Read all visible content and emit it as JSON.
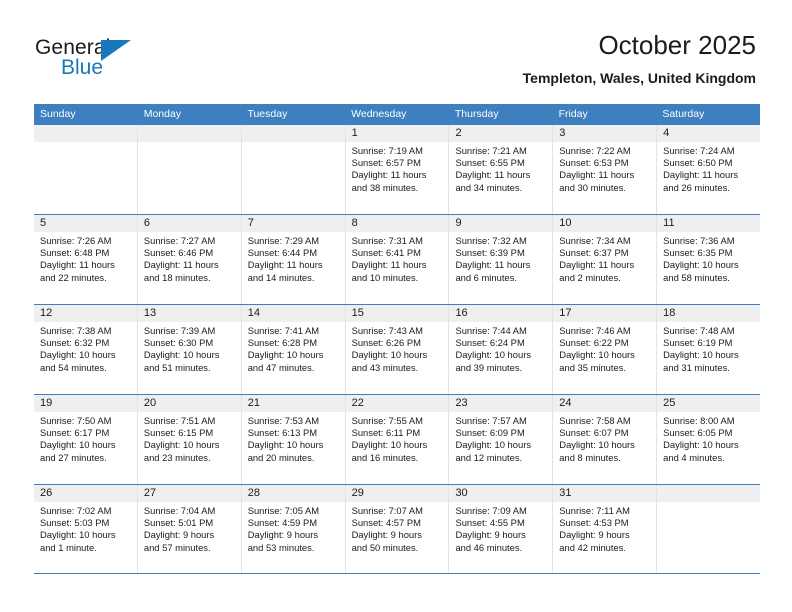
{
  "brand": {
    "name_top": "General",
    "name_bottom": "Blue",
    "triangle_icon": "triangle-icon",
    "accent_color": "#1878be"
  },
  "header": {
    "title": "October 2025",
    "subtitle": "Templeton, Wales, United Kingdom"
  },
  "theme": {
    "header_blue": "#3d7fbf",
    "day_strip_gray": "#efefef",
    "cell_border": "#e3e3e3",
    "text": "#1b1b1b"
  },
  "weekdays": [
    "Sunday",
    "Monday",
    "Tuesday",
    "Wednesday",
    "Thursday",
    "Friday",
    "Saturday"
  ],
  "weeks": [
    [
      {
        "day": "",
        "sunrise": "",
        "sunset": "",
        "daylight1": "",
        "daylight2": ""
      },
      {
        "day": "",
        "sunrise": "",
        "sunset": "",
        "daylight1": "",
        "daylight2": ""
      },
      {
        "day": "",
        "sunrise": "",
        "sunset": "",
        "daylight1": "",
        "daylight2": ""
      },
      {
        "day": "1",
        "sunrise": "Sunrise: 7:19 AM",
        "sunset": "Sunset: 6:57 PM",
        "daylight1": "Daylight: 11 hours",
        "daylight2": "and 38 minutes."
      },
      {
        "day": "2",
        "sunrise": "Sunrise: 7:21 AM",
        "sunset": "Sunset: 6:55 PM",
        "daylight1": "Daylight: 11 hours",
        "daylight2": "and 34 minutes."
      },
      {
        "day": "3",
        "sunrise": "Sunrise: 7:22 AM",
        "sunset": "Sunset: 6:53 PM",
        "daylight1": "Daylight: 11 hours",
        "daylight2": "and 30 minutes."
      },
      {
        "day": "4",
        "sunrise": "Sunrise: 7:24 AM",
        "sunset": "Sunset: 6:50 PM",
        "daylight1": "Daylight: 11 hours",
        "daylight2": "and 26 minutes."
      }
    ],
    [
      {
        "day": "5",
        "sunrise": "Sunrise: 7:26 AM",
        "sunset": "Sunset: 6:48 PM",
        "daylight1": "Daylight: 11 hours",
        "daylight2": "and 22 minutes."
      },
      {
        "day": "6",
        "sunrise": "Sunrise: 7:27 AM",
        "sunset": "Sunset: 6:46 PM",
        "daylight1": "Daylight: 11 hours",
        "daylight2": "and 18 minutes."
      },
      {
        "day": "7",
        "sunrise": "Sunrise: 7:29 AM",
        "sunset": "Sunset: 6:44 PM",
        "daylight1": "Daylight: 11 hours",
        "daylight2": "and 14 minutes."
      },
      {
        "day": "8",
        "sunrise": "Sunrise: 7:31 AM",
        "sunset": "Sunset: 6:41 PM",
        "daylight1": "Daylight: 11 hours",
        "daylight2": "and 10 minutes."
      },
      {
        "day": "9",
        "sunrise": "Sunrise: 7:32 AM",
        "sunset": "Sunset: 6:39 PM",
        "daylight1": "Daylight: 11 hours",
        "daylight2": "and 6 minutes."
      },
      {
        "day": "10",
        "sunrise": "Sunrise: 7:34 AM",
        "sunset": "Sunset: 6:37 PM",
        "daylight1": "Daylight: 11 hours",
        "daylight2": "and 2 minutes."
      },
      {
        "day": "11",
        "sunrise": "Sunrise: 7:36 AM",
        "sunset": "Sunset: 6:35 PM",
        "daylight1": "Daylight: 10 hours",
        "daylight2": "and 58 minutes."
      }
    ],
    [
      {
        "day": "12",
        "sunrise": "Sunrise: 7:38 AM",
        "sunset": "Sunset: 6:32 PM",
        "daylight1": "Daylight: 10 hours",
        "daylight2": "and 54 minutes."
      },
      {
        "day": "13",
        "sunrise": "Sunrise: 7:39 AM",
        "sunset": "Sunset: 6:30 PM",
        "daylight1": "Daylight: 10 hours",
        "daylight2": "and 51 minutes."
      },
      {
        "day": "14",
        "sunrise": "Sunrise: 7:41 AM",
        "sunset": "Sunset: 6:28 PM",
        "daylight1": "Daylight: 10 hours",
        "daylight2": "and 47 minutes."
      },
      {
        "day": "15",
        "sunrise": "Sunrise: 7:43 AM",
        "sunset": "Sunset: 6:26 PM",
        "daylight1": "Daylight: 10 hours",
        "daylight2": "and 43 minutes."
      },
      {
        "day": "16",
        "sunrise": "Sunrise: 7:44 AM",
        "sunset": "Sunset: 6:24 PM",
        "daylight1": "Daylight: 10 hours",
        "daylight2": "and 39 minutes."
      },
      {
        "day": "17",
        "sunrise": "Sunrise: 7:46 AM",
        "sunset": "Sunset: 6:22 PM",
        "daylight1": "Daylight: 10 hours",
        "daylight2": "and 35 minutes."
      },
      {
        "day": "18",
        "sunrise": "Sunrise: 7:48 AM",
        "sunset": "Sunset: 6:19 PM",
        "daylight1": "Daylight: 10 hours",
        "daylight2": "and 31 minutes."
      }
    ],
    [
      {
        "day": "19",
        "sunrise": "Sunrise: 7:50 AM",
        "sunset": "Sunset: 6:17 PM",
        "daylight1": "Daylight: 10 hours",
        "daylight2": "and 27 minutes."
      },
      {
        "day": "20",
        "sunrise": "Sunrise: 7:51 AM",
        "sunset": "Sunset: 6:15 PM",
        "daylight1": "Daylight: 10 hours",
        "daylight2": "and 23 minutes."
      },
      {
        "day": "21",
        "sunrise": "Sunrise: 7:53 AM",
        "sunset": "Sunset: 6:13 PM",
        "daylight1": "Daylight: 10 hours",
        "daylight2": "and 20 minutes."
      },
      {
        "day": "22",
        "sunrise": "Sunrise: 7:55 AM",
        "sunset": "Sunset: 6:11 PM",
        "daylight1": "Daylight: 10 hours",
        "daylight2": "and 16 minutes."
      },
      {
        "day": "23",
        "sunrise": "Sunrise: 7:57 AM",
        "sunset": "Sunset: 6:09 PM",
        "daylight1": "Daylight: 10 hours",
        "daylight2": "and 12 minutes."
      },
      {
        "day": "24",
        "sunrise": "Sunrise: 7:58 AM",
        "sunset": "Sunset: 6:07 PM",
        "daylight1": "Daylight: 10 hours",
        "daylight2": "and 8 minutes."
      },
      {
        "day": "25",
        "sunrise": "Sunrise: 8:00 AM",
        "sunset": "Sunset: 6:05 PM",
        "daylight1": "Daylight: 10 hours",
        "daylight2": "and 4 minutes."
      }
    ],
    [
      {
        "day": "26",
        "sunrise": "Sunrise: 7:02 AM",
        "sunset": "Sunset: 5:03 PM",
        "daylight1": "Daylight: 10 hours",
        "daylight2": "and 1 minute."
      },
      {
        "day": "27",
        "sunrise": "Sunrise: 7:04 AM",
        "sunset": "Sunset: 5:01 PM",
        "daylight1": "Daylight: 9 hours",
        "daylight2": "and 57 minutes."
      },
      {
        "day": "28",
        "sunrise": "Sunrise: 7:05 AM",
        "sunset": "Sunset: 4:59 PM",
        "daylight1": "Daylight: 9 hours",
        "daylight2": "and 53 minutes."
      },
      {
        "day": "29",
        "sunrise": "Sunrise: 7:07 AM",
        "sunset": "Sunset: 4:57 PM",
        "daylight1": "Daylight: 9 hours",
        "daylight2": "and 50 minutes."
      },
      {
        "day": "30",
        "sunrise": "Sunrise: 7:09 AM",
        "sunset": "Sunset: 4:55 PM",
        "daylight1": "Daylight: 9 hours",
        "daylight2": "and 46 minutes."
      },
      {
        "day": "31",
        "sunrise": "Sunrise: 7:11 AM",
        "sunset": "Sunset: 4:53 PM",
        "daylight1": "Daylight: 9 hours",
        "daylight2": "and 42 minutes."
      },
      {
        "day": "",
        "sunrise": "",
        "sunset": "",
        "daylight1": "",
        "daylight2": ""
      }
    ]
  ]
}
